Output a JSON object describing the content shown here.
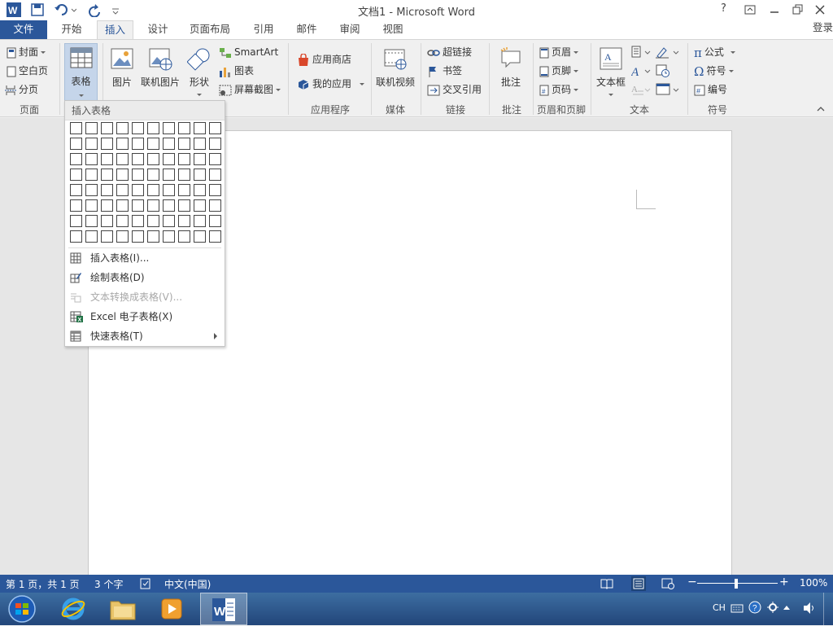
{
  "window": {
    "title": "文档1 - Microsoft Word",
    "help": "?"
  },
  "tabs": [
    "文件",
    "开始",
    "插入",
    "设计",
    "页面布局",
    "引用",
    "邮件",
    "审阅",
    "视图"
  ],
  "login": "登录",
  "ribbon": {
    "pages": {
      "cover": "封面",
      "blank": "空白页",
      "break": "分页",
      "label": "页面"
    },
    "table": {
      "label": "表格"
    },
    "illustrations": {
      "picture": "图片",
      "online_picture": "联机图片",
      "shapes": "形状",
      "smartart": "SmartArt",
      "chart": "图表",
      "screenshot": "屏幕截图"
    },
    "apps": {
      "store": "应用商店",
      "my_apps": "我的应用",
      "label": "应用程序"
    },
    "media": {
      "online_video": "联机视频",
      "label": "媒体"
    },
    "links": {
      "hyperlink": "超链接",
      "bookmark": "书签",
      "crossref": "交叉引用",
      "label": "链接"
    },
    "comments": {
      "comment": "批注",
      "label": "批注"
    },
    "header_footer": {
      "header": "页眉",
      "footer": "页脚",
      "page_number": "页码",
      "label": "页眉和页脚"
    },
    "text": {
      "textbox": "文本框",
      "label": "文本"
    },
    "symbols": {
      "equation": "公式",
      "symbol": "符号",
      "number": "编号",
      "label": "符号"
    }
  },
  "dropdown": {
    "header": "插入表格",
    "items": [
      {
        "label": "插入表格(I)...",
        "enabled": true
      },
      {
        "label": "绘制表格(D)",
        "enabled": true
      },
      {
        "label": "文本转换成表格(V)...",
        "enabled": false
      },
      {
        "label": "Excel 电子表格(X)",
        "enabled": true
      },
      {
        "label": "快速表格(T)",
        "enabled": true
      }
    ]
  },
  "status": {
    "page": "第 1 页，共 1 页",
    "words": "3 个字",
    "language": "中文(中国)",
    "zoom": "100%"
  },
  "taskbar": {
    "ime": "CH"
  },
  "colors": {
    "accent": "#2b579a"
  }
}
